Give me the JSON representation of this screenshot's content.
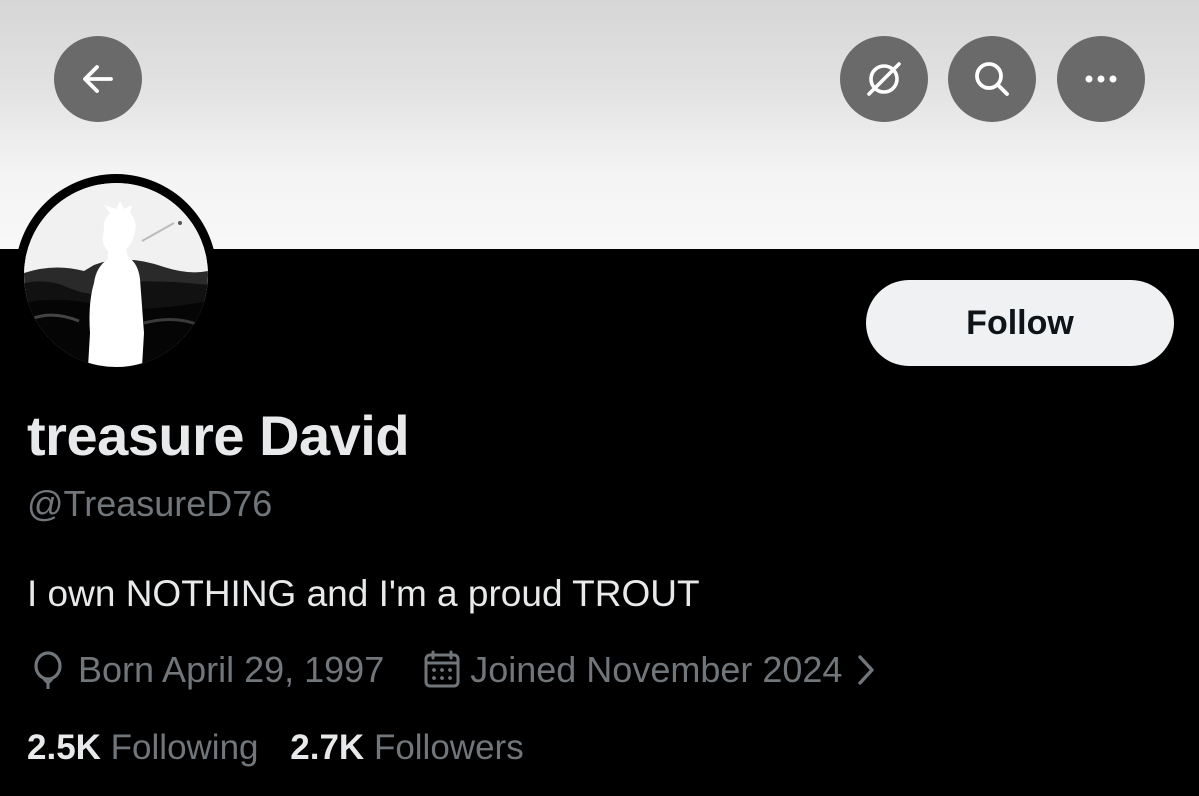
{
  "header": {
    "back_icon": "arrow-left-icon",
    "grok_icon": "slashed-circle-icon",
    "search_icon": "search-icon",
    "more_icon": "more-dots-icon"
  },
  "profile": {
    "follow_label": "Follow",
    "display_name": "treasure David",
    "handle": "@TreasureD76",
    "bio": "I own NOTHING and I'm a proud TROUT",
    "birthday": "Born April 29, 1997",
    "joined": "Joined November 2024",
    "following_count": "2.5K",
    "following_label": "Following",
    "followers_count": "2.7K",
    "followers_label": "Followers"
  },
  "colors": {
    "background": "#000000",
    "primary_text": "#e7e9ea",
    "secondary_text": "#71767b",
    "header_button": "#6a6a6a",
    "follow_button_bg": "#eff1f2"
  }
}
